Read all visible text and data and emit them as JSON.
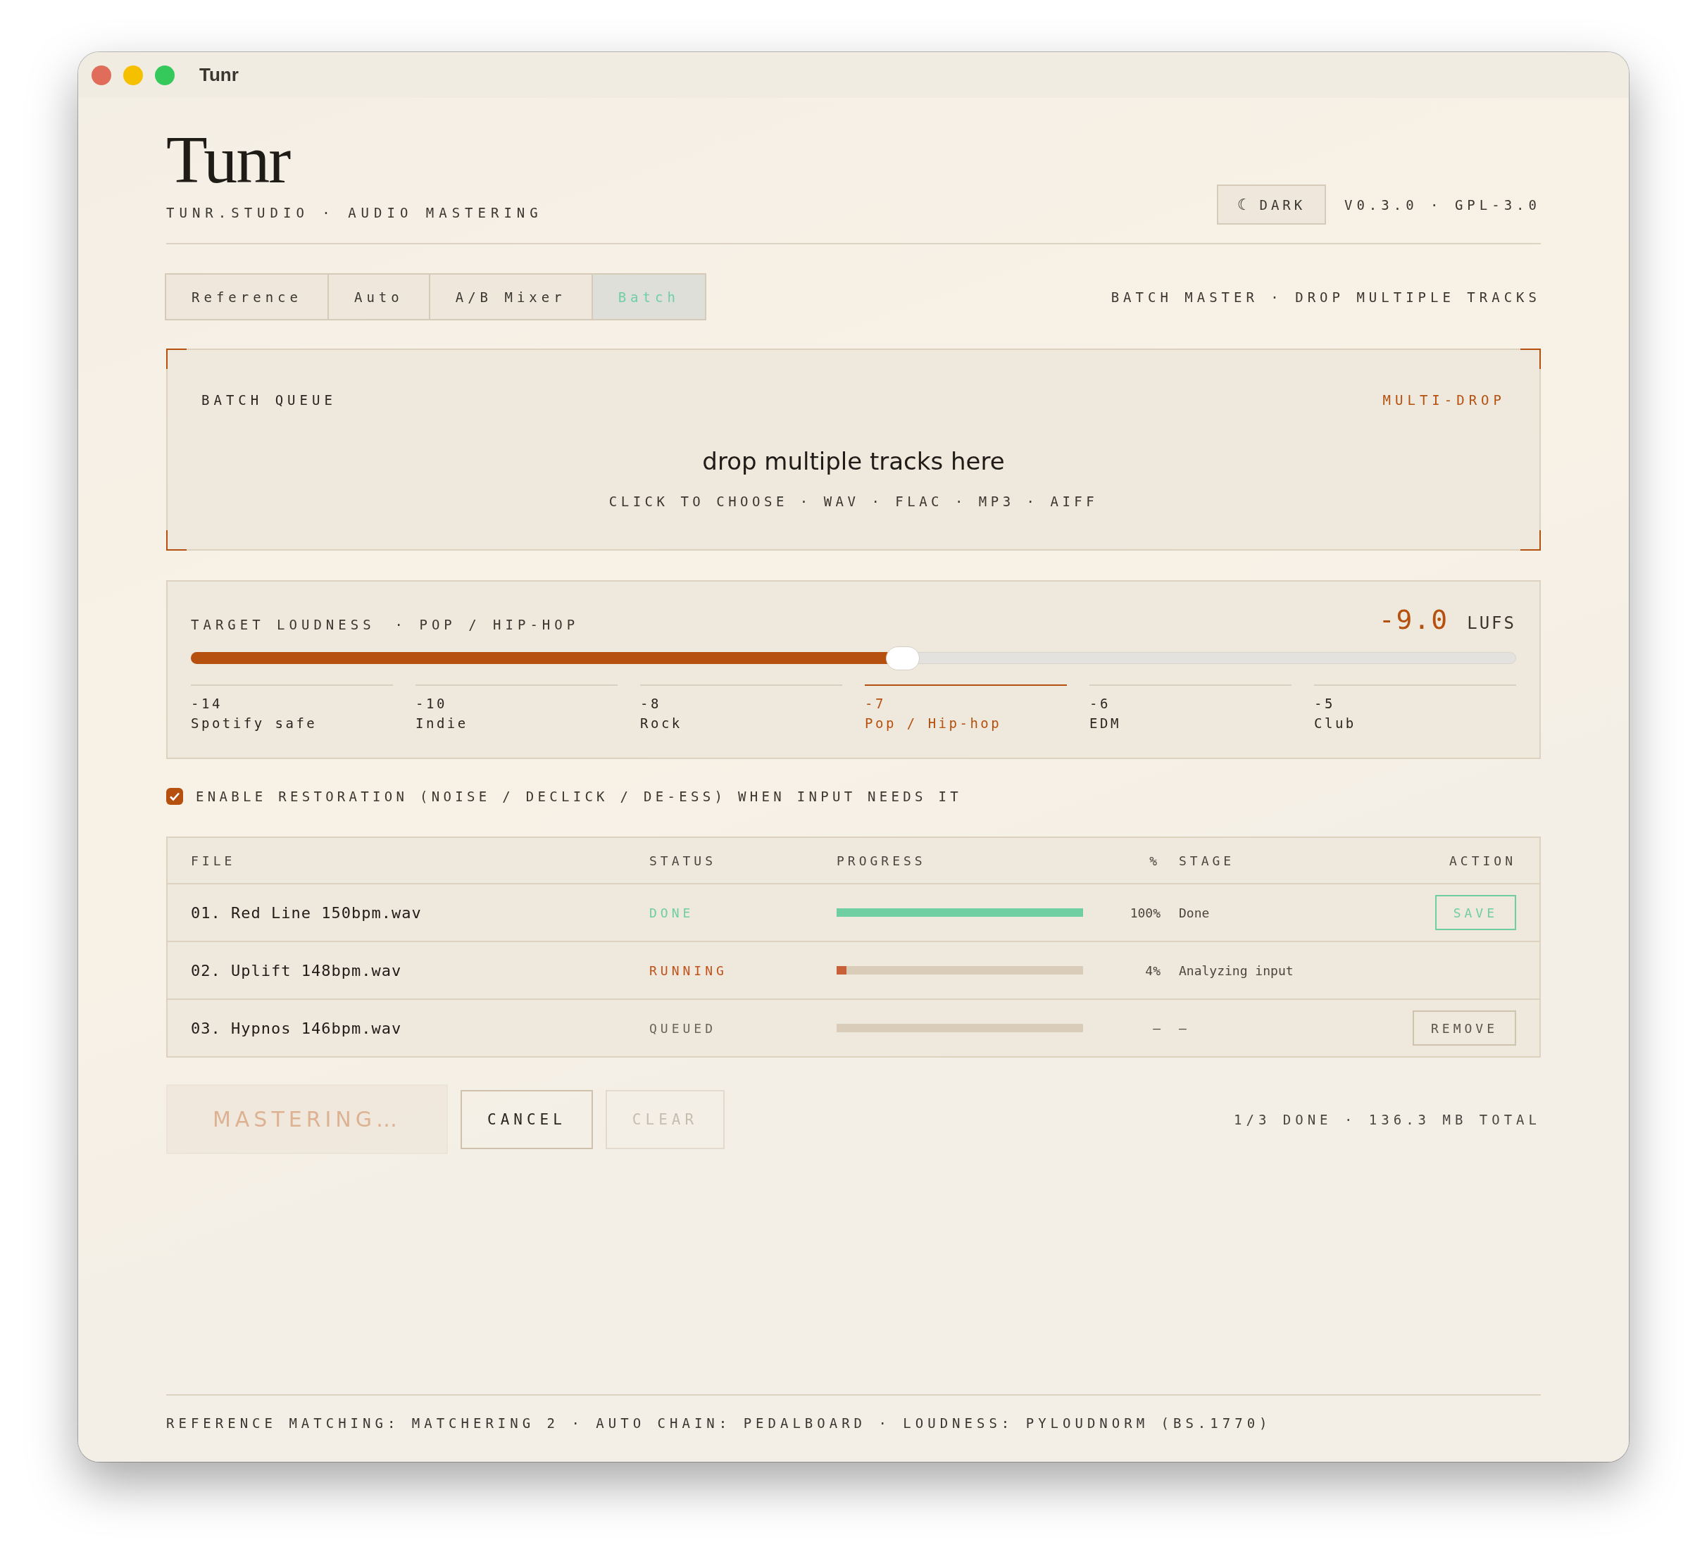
{
  "window": {
    "title": "Tunr"
  },
  "header": {
    "logo": "Tunr",
    "tagline": "TUNR.STUDIO · AUDIO MASTERING",
    "theme_button": {
      "icon": "☾",
      "label": "DARK"
    },
    "version": "V0.3.0 · GPL-3.0"
  },
  "tabs": [
    {
      "label": "Reference",
      "selected": false
    },
    {
      "label": "Auto",
      "selected": false
    },
    {
      "label": "A/B Mixer",
      "selected": false
    },
    {
      "label": "Batch",
      "selected": true
    }
  ],
  "mode_caption": "BATCH MASTER · DROP MULTIPLE TRACKS",
  "dropzone": {
    "title": "BATCH QUEUE",
    "badge": "MULTI-DROP",
    "prompt": "drop multiple tracks here",
    "hint": "CLICK TO CHOOSE · WAV · FLAC · MP3 · AIFF"
  },
  "loudness": {
    "label": "TARGET LOUDNESS",
    "preset": "· POP / HIP-HOP",
    "value": "-9.0",
    "unit": "LUFS",
    "level": 0.537,
    "presets": [
      {
        "value": "-14",
        "name": "Spotify safe",
        "selected": false
      },
      {
        "value": "-10",
        "name": "Indie",
        "selected": false
      },
      {
        "value": "-8",
        "name": "Rock",
        "selected": false
      },
      {
        "value": "-7",
        "name": "Pop / Hip-hop",
        "selected": true
      },
      {
        "value": "-6",
        "name": "EDM",
        "selected": false
      },
      {
        "value": "-5",
        "name": "Club",
        "selected": false
      }
    ]
  },
  "restoration": {
    "checked": true,
    "label": "ENABLE RESTORATION (NOISE / DECLICK / DE-ESS) WHEN INPUT NEEDS IT"
  },
  "queue": {
    "columns": [
      "FILE",
      "STATUS",
      "PROGRESS",
      "%",
      "STAGE",
      "ACTION"
    ],
    "rows": [
      {
        "file": "01. Red Line 150bpm.wav",
        "status": "DONE",
        "kind": "done",
        "level": 1,
        "percent": "100%",
        "stage": "Done",
        "action": "SAVE"
      },
      {
        "file": "02. Uplift 148bpm.wav",
        "status": "RUNNING",
        "kind": "running",
        "level": 0.04,
        "percent": "4%",
        "stage": "Analyzing input"
      },
      {
        "file": "03. Hypnos 146bpm.wav",
        "status": "QUEUED",
        "kind": "queued",
        "level": 0,
        "percent": "–",
        "stage": "–",
        "action": "REMOVE"
      }
    ]
  },
  "actions": [
    {
      "label": "MASTERING…",
      "kind": "primary",
      "disabled": true
    },
    {
      "label": "CANCEL",
      "kind": "secondary",
      "disabled": false
    },
    {
      "label": "CLEAR",
      "kind": "secondary",
      "disabled": true
    }
  ],
  "summary": "1/3 DONE · 136.3 MB TOTAL",
  "footer": "REFERENCE MATCHING: MATCHERING 2 · AUTO CHAIN: PEDALBOARD · LOUDNESS: PYLOUDNORM (BS.1770)"
}
